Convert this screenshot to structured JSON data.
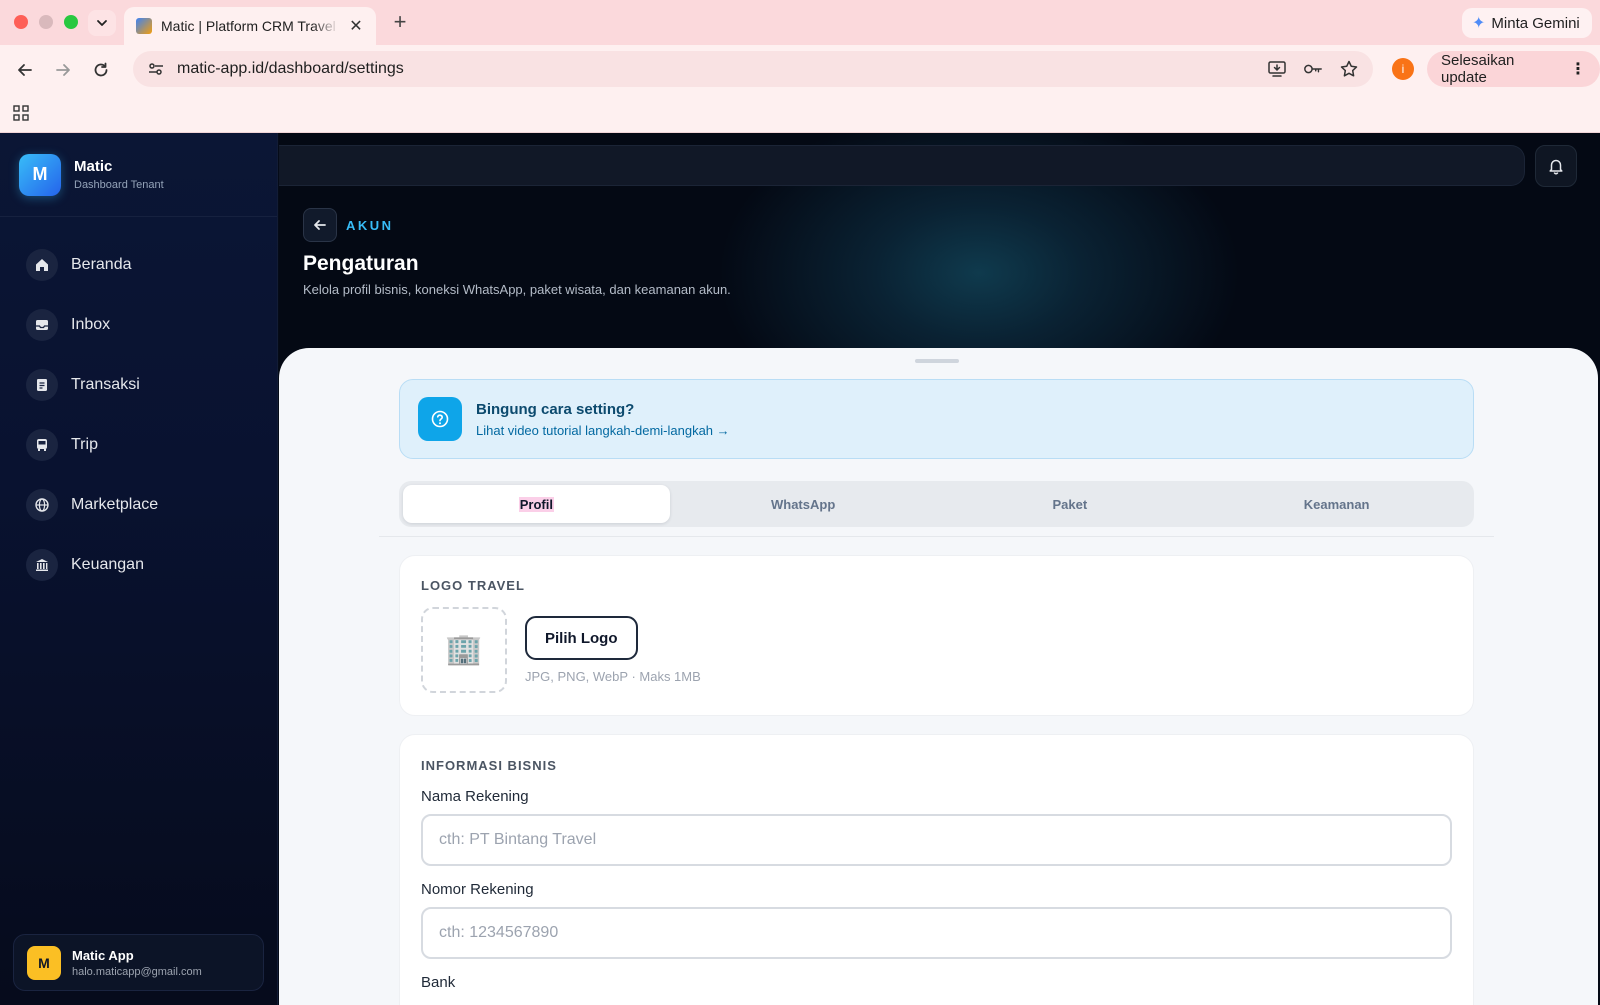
{
  "browser": {
    "tab_title": "Matic | Platform CRM Travel Dashboard",
    "url": "matic-app.id/dashboard/settings",
    "gemini_label": "Minta Gemini",
    "profile_initial": "i",
    "update_label": "Selesaikan update"
  },
  "sidebar": {
    "brand_initial": "M",
    "brand_name": "Matic",
    "brand_sub": "Dashboard Tenant",
    "items": [
      {
        "label": "Beranda",
        "icon": "home-icon"
      },
      {
        "label": "Inbox",
        "icon": "inbox-icon"
      },
      {
        "label": "Transaksi",
        "icon": "document-icon"
      },
      {
        "label": "Trip",
        "icon": "bus-icon"
      },
      {
        "label": "Marketplace",
        "icon": "globe-icon"
      },
      {
        "label": "Keuangan",
        "icon": "bank-icon"
      }
    ],
    "user": {
      "initial": "M",
      "name": "Matic App",
      "email": "halo.maticapp@gmail.com"
    }
  },
  "header": {
    "eyebrow": "AKUN",
    "title": "Pengaturan",
    "subtitle": "Kelola profil bisnis, koneksi WhatsApp, paket wisata, dan keamanan akun."
  },
  "help": {
    "title": "Bingung cara setting?",
    "link": "Lihat video tutorial langkah-demi-langkah →"
  },
  "tabs": [
    "Profil",
    "WhatsApp",
    "Paket",
    "Keamanan"
  ],
  "logo_section": {
    "title": "LOGO TRAVEL",
    "placeholder_emoji": "🏢",
    "button": "Pilih Logo",
    "hint": "JPG, PNG, WebP · Maks 1MB"
  },
  "business_section": {
    "title": "INFORMASI BISNIS",
    "fields": [
      {
        "label": "Nama Rekening",
        "placeholder": "cth: PT Bintang Travel"
      },
      {
        "label": "Nomor Rekening",
        "placeholder": "cth: 1234567890"
      },
      {
        "label": "Bank"
      }
    ]
  }
}
